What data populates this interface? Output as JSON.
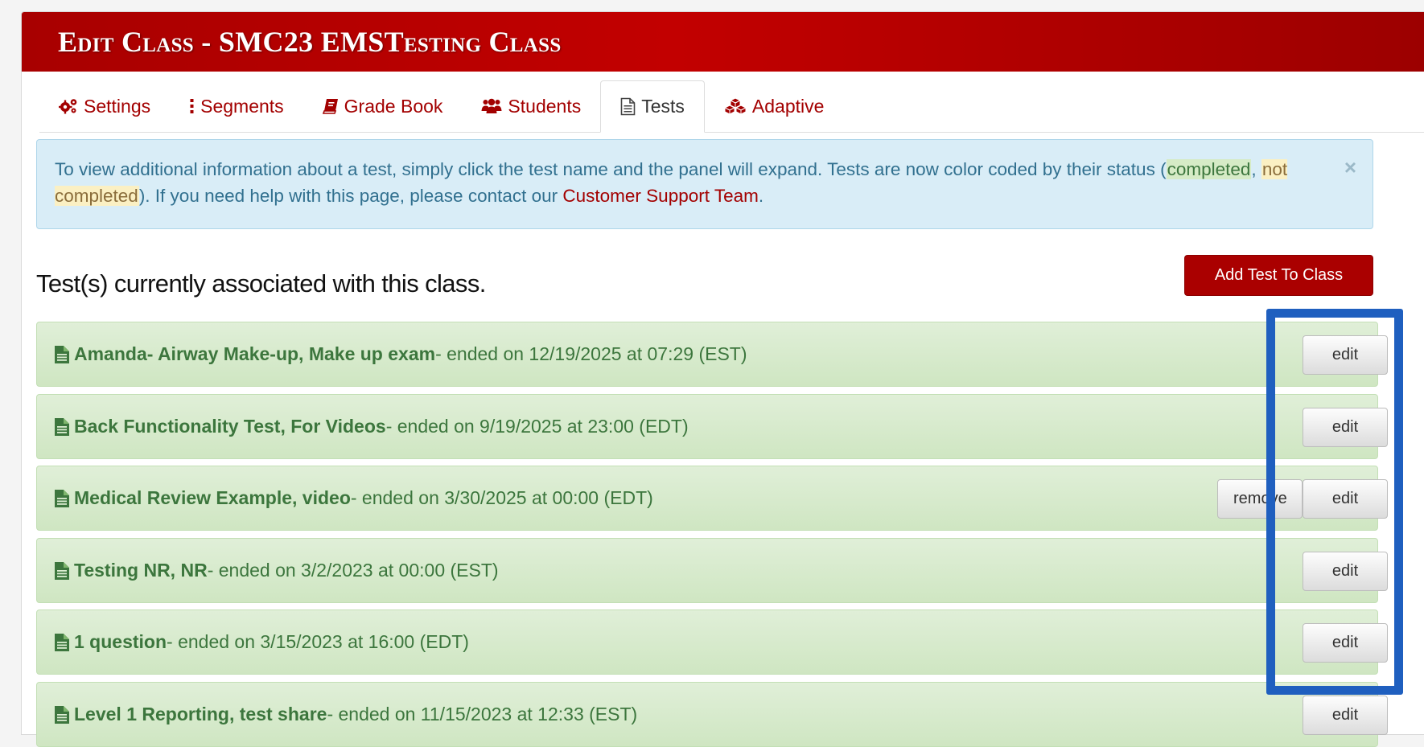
{
  "header": {
    "title": "Edit Class - SMC23 EMSTesting Class"
  },
  "tabs": [
    {
      "label": "Settings",
      "icon": "gears-icon",
      "active": false
    },
    {
      "label": "Segments",
      "icon": "vertical-ellipsis-icon",
      "active": false
    },
    {
      "label": "Grade Book",
      "icon": "book-icon",
      "active": false
    },
    {
      "label": "Students",
      "icon": "users-icon",
      "active": false
    },
    {
      "label": "Tests",
      "icon": "document-icon",
      "active": true
    },
    {
      "label": "Adaptive",
      "icon": "cubes-icon",
      "active": false
    }
  ],
  "alert": {
    "text_1": "To view additional information about a test, simply click the test name and the panel will expand. Tests are now color coded by their status (",
    "completed": "completed",
    "comma": ", ",
    "not_completed": "not completed",
    "text_2": "). If you need help with this page, please contact our ",
    "link": "Customer Support Team",
    "text_3": ".",
    "close": "×"
  },
  "section": {
    "title": "Test(s) currently associated with this class.",
    "add_button": "Add Test To Class"
  },
  "tests": [
    {
      "name": "Amanda- Airway Make-up, Make up exam",
      "ended": " - ended on 12/19/2025 at 07:29 (EST)"
    },
    {
      "name": "Back Functionality Test, For Videos",
      "ended": " - ended on 9/19/2025 at 23:00 (EDT)"
    },
    {
      "name": "Medical Review Example, video",
      "ended": " - ended on 3/30/2025 at 00:00 (EDT)",
      "remove": "remove"
    },
    {
      "name": "Testing NR, NR",
      "ended": " - ended on 3/2/2023 at 00:00 (EST)"
    },
    {
      "name": "1 question",
      "ended": " - ended on 3/15/2023 at 16:00 (EDT)"
    },
    {
      "name": "Level 1 Reporting, test share",
      "ended": " - ended on 11/15/2023 at 12:33 (EST)"
    }
  ],
  "buttons": {
    "edit": "edit"
  },
  "colors": {
    "header_red": "#c20000",
    "completed_green": "#3c763d",
    "info_blue": "#31708f",
    "highlight_blue": "#1f5fbf"
  }
}
